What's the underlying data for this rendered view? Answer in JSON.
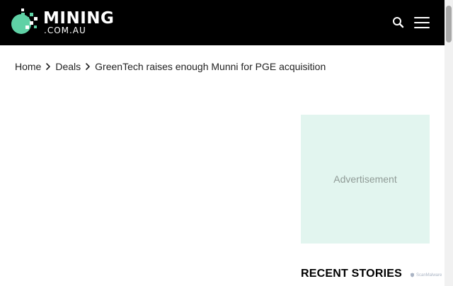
{
  "header": {
    "logo": {
      "word": "MINING",
      "sub": ".COM.AU"
    },
    "search_icon": "search-icon",
    "menu_icon": "hamburger-menu-icon"
  },
  "breadcrumb": {
    "items": [
      "Home",
      "Deals",
      "GreenTech raises enough Munni for PGE acquisition"
    ],
    "separator_icon": "chevron-right-icon"
  },
  "sidebar": {
    "ad_label": "Advertisement",
    "recent_stories_title": "RECENT STORIES"
  },
  "badge": {
    "text": "ScanMalware"
  },
  "colors": {
    "header_bg": "#000000",
    "logo_accent": "#5fd1a5",
    "ad_bg": "#e2f5ef"
  }
}
